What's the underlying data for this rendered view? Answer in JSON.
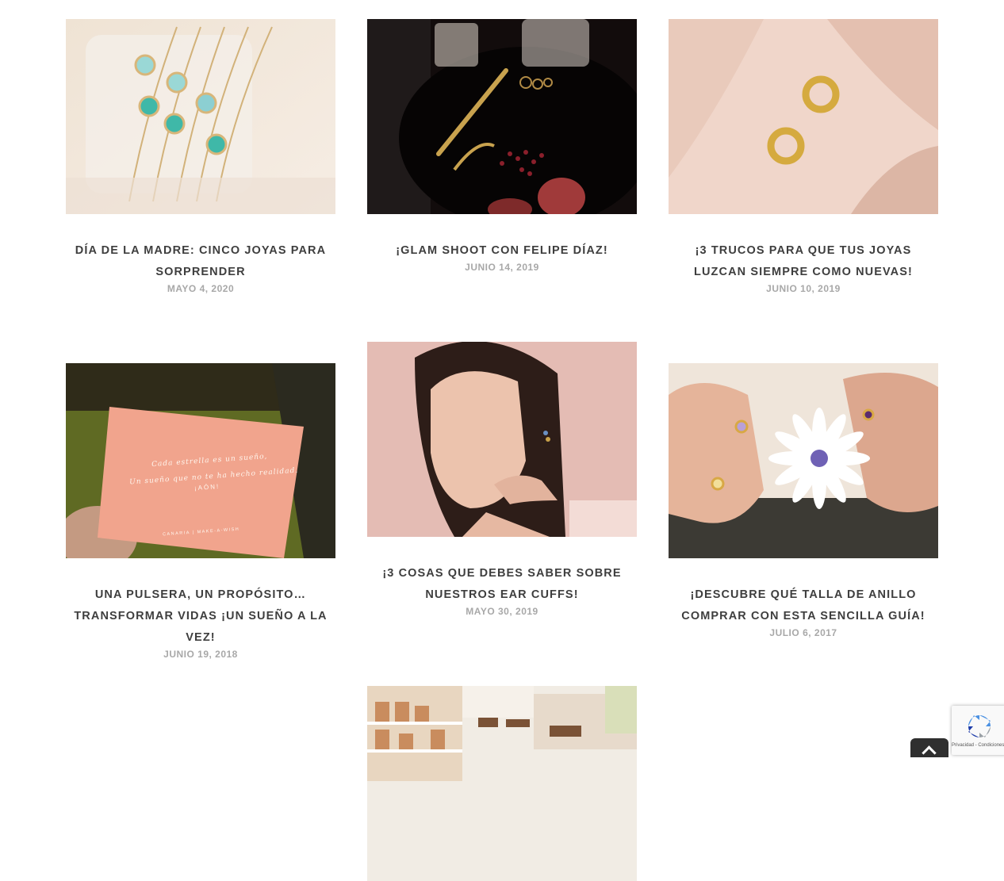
{
  "posts": [
    {
      "title": "DÍA DE LA MADRE: CINCO JOYAS PARA SORPRENDER",
      "date": "MAYO 4, 2020",
      "image": "bracelets-with-turquoise-stones-photo"
    },
    {
      "title": "¡GLAM SHOOT CON FELIPE DÍAZ!",
      "date": "JUNIO 14, 2019",
      "image": "dark-table-jewelry-pomegranate-photo"
    },
    {
      "title": "¡3 TRUCOS PARA QUE TUS JOYAS LUZCAN SIEMPRE COMO NUEVAS!",
      "date": "JUNIO 10, 2019",
      "image": "gold-hoop-earrings-on-fabric-photo"
    },
    {
      "title": "UNA PULSERA, UN PROPÓSITO… TRANSFORMAR VIDAS ¡UN SUEÑO A LA VEZ!",
      "date": "JUNIO 19, 2018",
      "image": "pink-card-in-hand-photo"
    },
    {
      "title": "¡3 COSAS QUE DEBES SABER SOBRE NUESTROS EAR CUFFS!",
      "date": "MAYO 30, 2019",
      "image": "woman-with-ear-cuff-portrait-photo"
    },
    {
      "title": "¡DESCUBRE QUÉ TALLA DE ANILLO COMPRAR CON ESTA SENCILLA GUÍA!",
      "date": "JULIO 6, 2017",
      "image": "hands-with-rings-and-daisy-photo"
    },
    {
      "title": "",
      "date": "",
      "image": "shop-interior-shelves-photo"
    }
  ],
  "card_text": {
    "line1": "Cada estrella es un sueño,",
    "line2": "Un sueño que no te ha hecho realidad.",
    "line3": "¡AÓN!",
    "footer": "CANARIA | MAKE-A-WISH"
  },
  "recaptcha": {
    "terms": "Privacidad - Condiciones"
  },
  "colors": {
    "title": "#3e3e3e",
    "date": "#a8a8a8",
    "scroll_button": "#2f2f2f"
  },
  "icons": {
    "scroll_top": "chevron-up-icon",
    "recaptcha": "recaptcha-icon"
  }
}
